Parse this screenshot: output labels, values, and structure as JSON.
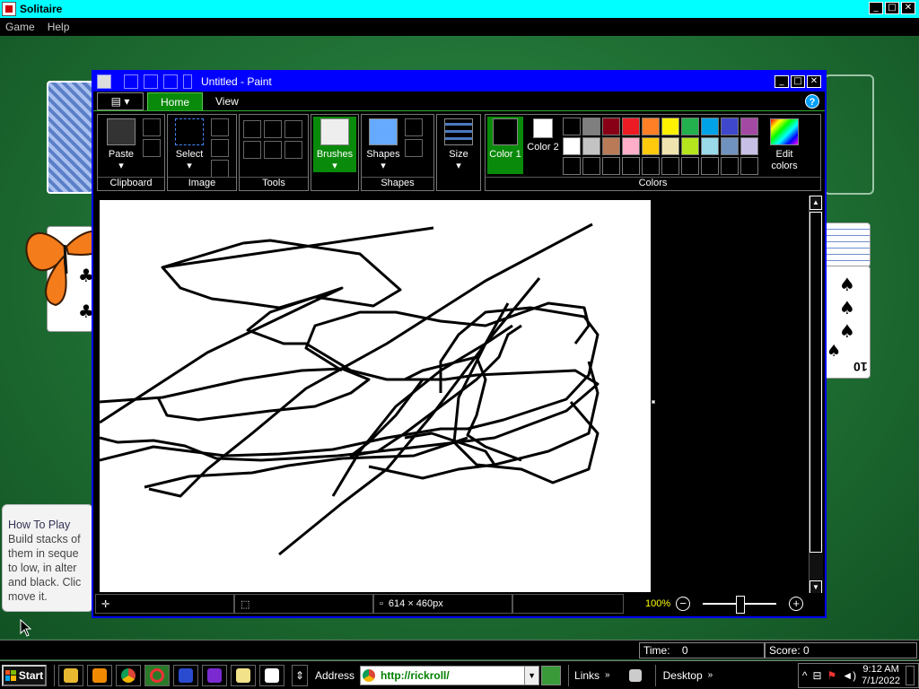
{
  "solitaire": {
    "title": "Solitaire",
    "menu": [
      "Game",
      "Help"
    ],
    "howto": {
      "title": "How To Play",
      "body": "Build stacks of them in seque to low, in alter and black. Clic move it."
    },
    "status": {
      "time_label": "Time:",
      "time_value": "0",
      "score_label": "Score:",
      "score_value": "0"
    },
    "card_ranks": [
      "10"
    ]
  },
  "paint": {
    "title": "Untitled - Paint",
    "tabs": [
      "Home",
      "View"
    ],
    "active_tab": "Home",
    "groups": {
      "clipboard": {
        "label": "Clipboard",
        "paste": "Paste"
      },
      "image": {
        "label": "Image",
        "select": "Select"
      },
      "tools": {
        "label": "Tools"
      },
      "brushes": {
        "label": "Brushes"
      },
      "shapes": {
        "label": "Shapes",
        "shapes_btn": "Shapes"
      },
      "size": {
        "label": "Size"
      },
      "colors": {
        "label": "Colors",
        "color1": "Color 1",
        "color2": "Color 2",
        "edit": "Edit colors"
      }
    },
    "palette_row1": [
      "#000000",
      "#7f7f7f",
      "#880015",
      "#ed1c24",
      "#ff7f27",
      "#fff200",
      "#22b14c",
      "#00a2e8",
      "#3f48cc",
      "#a349a4"
    ],
    "palette_row2": [
      "#ffffff",
      "#c3c3c3",
      "#b97a57",
      "#ffaec9",
      "#ffc90e",
      "#efe4b0",
      "#b5e61d",
      "#99d9ea",
      "#7092be",
      "#c8bfe7"
    ],
    "status": {
      "dimensions": "614 × 460px",
      "zoom": "100%"
    }
  },
  "taskbar": {
    "start": "Start",
    "address_label": "Address",
    "address_value": "http://rickroll/",
    "links": "Links",
    "desktop": "Desktop",
    "time": "9:12 AM",
    "date": "7/1/2022"
  },
  "colors": {
    "accent_cyan": "#00ffff",
    "paint_titlebar": "#0000ff",
    "ribbon_active": "#0a8a0a",
    "felt": "#1f6b33"
  }
}
